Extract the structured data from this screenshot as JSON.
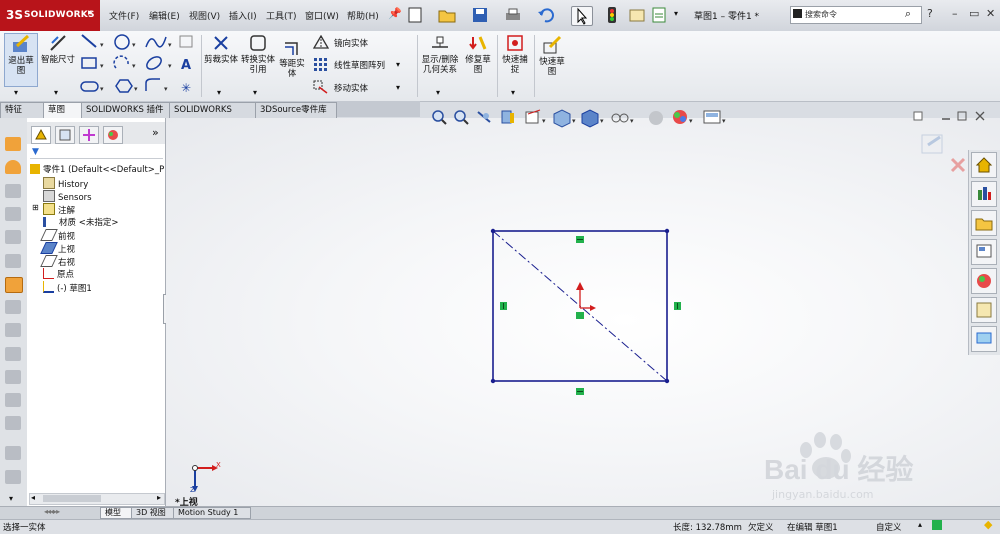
{
  "app": {
    "logo_text": "SOLIDWORKS",
    "logo_mark": "3S"
  },
  "menu": [
    "文件(F)",
    "编辑(E)",
    "视图(V)",
    "插入(I)",
    "工具(T)",
    "窗口(W)",
    "帮助(H)"
  ],
  "doc_title": "草图1 – 零件1 *",
  "search": {
    "placeholder": "搜索命令"
  },
  "window_controls": [
    "?",
    "–",
    "▭",
    "✕"
  ],
  "commands": {
    "exit_sketch": "退出草图",
    "smart_dimension": "智能尺寸",
    "trim": "剪裁实体",
    "convert": "转换实体引用",
    "offset": "等距实体",
    "mirror": "镜向实体",
    "linear_pattern": "线性草图阵列",
    "move": "移动实体",
    "show_relations": "显示/删除几何关系",
    "repair": "修复草图",
    "quick_snaps": "快速捕捉",
    "rapid_sketch": "快速草图"
  },
  "cm_tabs": [
    "特征",
    "草图",
    "SOLIDWORKS 插件",
    "SOLIDWORKS MBD",
    "3DSource零件库"
  ],
  "cm_active_tab": "草图",
  "tree": {
    "root": "零件1 (Default<<Default>_P",
    "items": [
      "History",
      "Sensors",
      "注解",
      "材质 <未指定>",
      "前视",
      "上视",
      "右视",
      "原点",
      "(-) 草图1"
    ]
  },
  "view_label": "*上视",
  "triad": {
    "x": "X",
    "y": "Y",
    "z": "Z"
  },
  "bottom_tabs": [
    "模型",
    "3D 视图",
    "Motion Study 1"
  ],
  "bottom_active_tab": "模型",
  "status": {
    "left": "选择一实体",
    "length": "长度: 132.78mm",
    "defined": "欠定义",
    "editing": "在编辑 草图1",
    "custom": "自定义"
  },
  "watermark": {
    "brand": "Bai du 经验",
    "url": "jingyan.baidu.com"
  },
  "colors": {
    "sketch_line": "#1a1f8f",
    "relation_box": "#22b14c",
    "origin": "#d21d1d",
    "logo_bg": "#b8141a"
  }
}
